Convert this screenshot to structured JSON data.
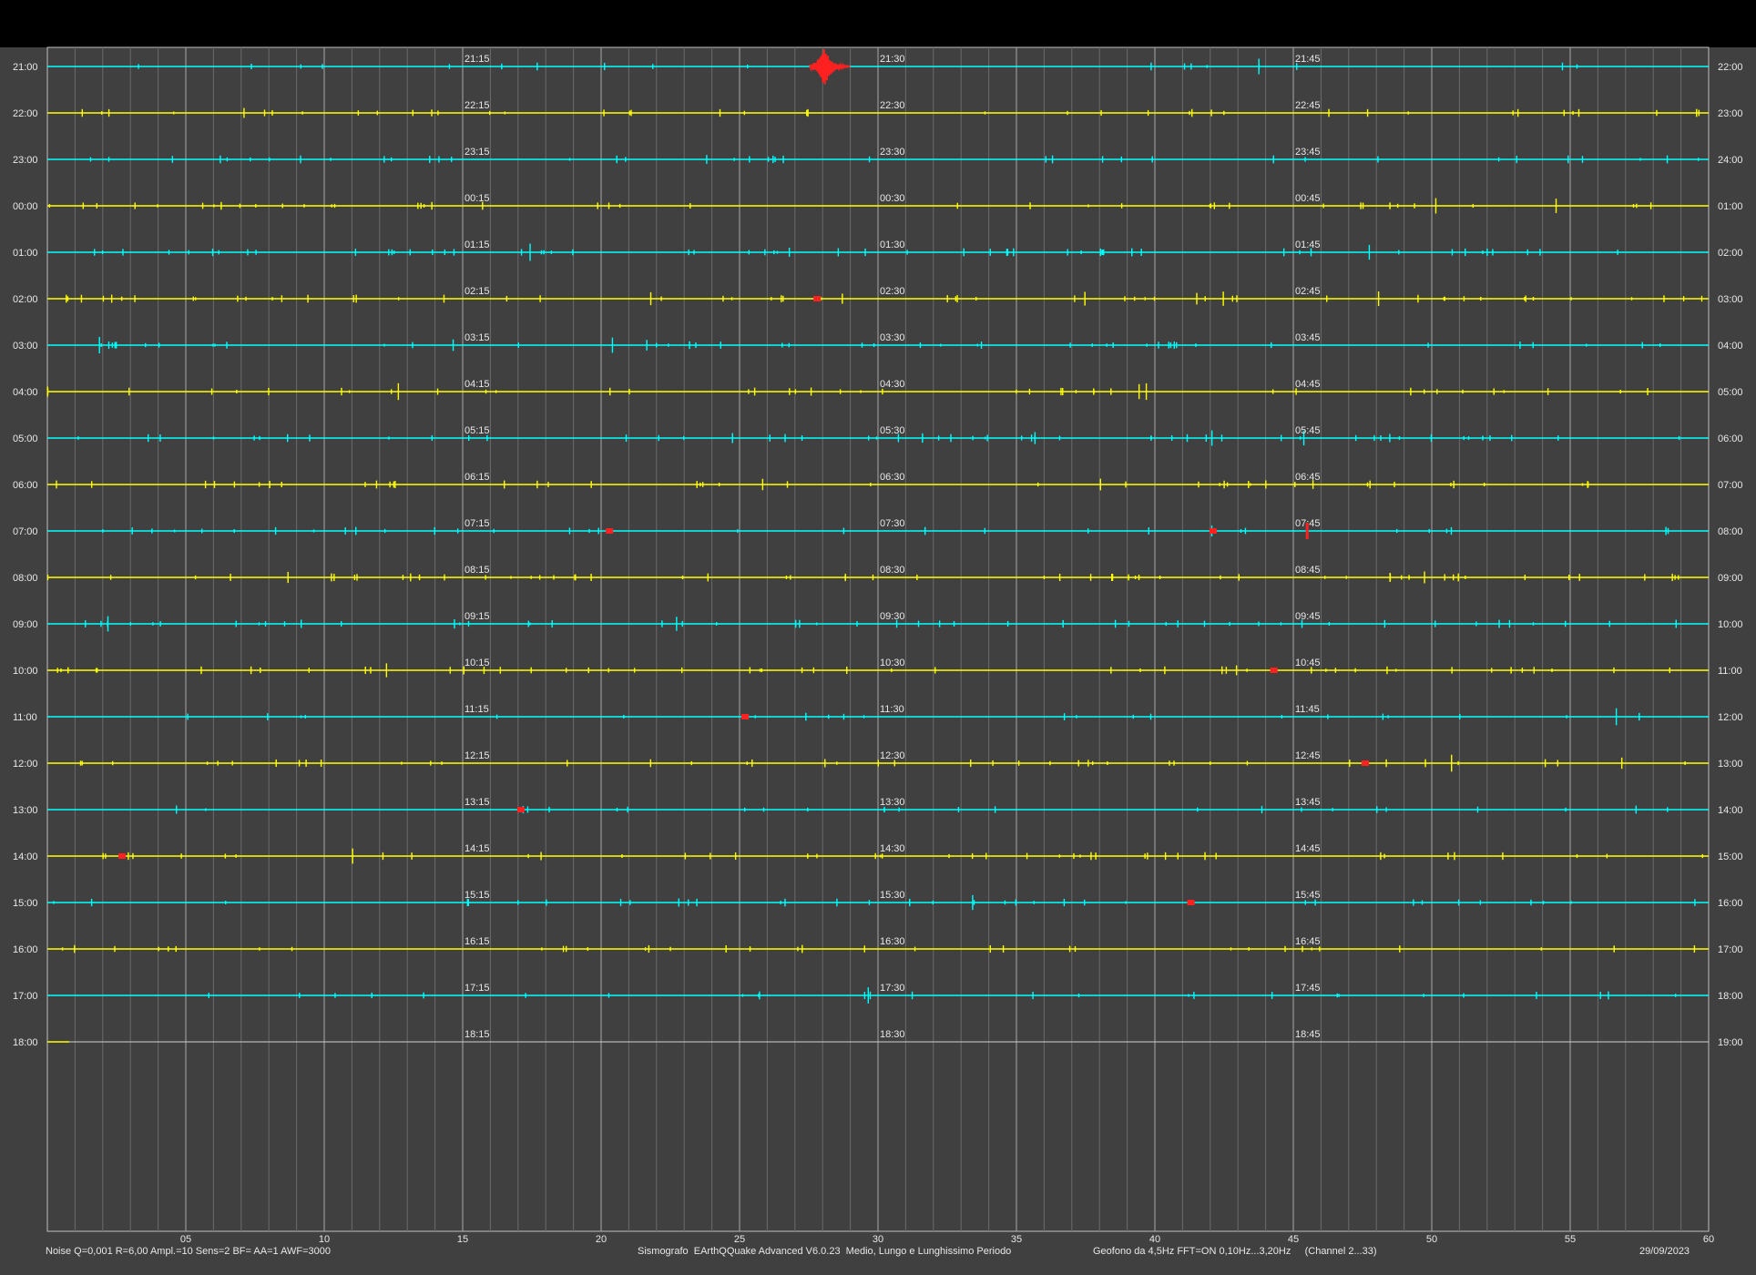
{
  "chart_data": {
    "type": "seismogram",
    "date": "29/09/2023",
    "x_axis_ticks": [
      "05",
      "10",
      "15",
      "20",
      "25",
      "30",
      "35",
      "40",
      "45",
      "50",
      "55",
      "60"
    ],
    "x_range_minutes": [
      0,
      60
    ],
    "trace_colors": [
      "#00ffff",
      "#ffff00"
    ],
    "event_color": "#ff2020",
    "rows": [
      {
        "left": "21:00",
        "right": "22:00",
        "q15": "21:15",
        "q30": "21:30",
        "q45": "21:45"
      },
      {
        "left": "22:00",
        "right": "23:00",
        "q15": "22:15",
        "q30": "22:30",
        "q45": "22:45"
      },
      {
        "left": "23:00",
        "right": "24:00",
        "q15": "23:15",
        "q30": "23:30",
        "q45": "23:45"
      },
      {
        "left": "00:00",
        "right": "01:00",
        "q15": "00:15",
        "q30": "00:30",
        "q45": "00:45"
      },
      {
        "left": "01:00",
        "right": "02:00",
        "q15": "01:15",
        "q30": "01:30",
        "q45": "01:45"
      },
      {
        "left": "02:00",
        "right": "03:00",
        "q15": "02:15",
        "q30": "02:30",
        "q45": "02:45"
      },
      {
        "left": "03:00",
        "right": "04:00",
        "q15": "03:15",
        "q30": "03:30",
        "q45": "03:45"
      },
      {
        "left": "04:00",
        "right": "05:00",
        "q15": "04:15",
        "q30": "04:30",
        "q45": "04:45"
      },
      {
        "left": "05:00",
        "right": "06:00",
        "q15": "05:15",
        "q30": "05:30",
        "q45": "05:45"
      },
      {
        "left": "06:00",
        "right": "07:00",
        "q15": "06:15",
        "q30": "06:30",
        "q45": "06:45"
      },
      {
        "left": "07:00",
        "right": "08:00",
        "q15": "07:15",
        "q30": "07:30",
        "q45": "07:45"
      },
      {
        "left": "08:00",
        "right": "09:00",
        "q15": "08:15",
        "q30": "08:30",
        "q45": "08:45"
      },
      {
        "left": "09:00",
        "right": "10:00",
        "q15": "09:15",
        "q30": "09:30",
        "q45": "09:45"
      },
      {
        "left": "10:00",
        "right": "11:00",
        "q15": "10:15",
        "q30": "10:30",
        "q45": "10:45"
      },
      {
        "left": "11:00",
        "right": "12:00",
        "q15": "11:15",
        "q30": "11:30",
        "q45": "11:45"
      },
      {
        "left": "12:00",
        "right": "13:00",
        "q15": "12:15",
        "q30": "12:30",
        "q45": "12:45"
      },
      {
        "left": "13:00",
        "right": "14:00",
        "q15": "13:15",
        "q30": "13:30",
        "q45": "13:45"
      },
      {
        "left": "14:00",
        "right": "15:00",
        "q15": "14:15",
        "q30": "14:30",
        "q45": "14:45"
      },
      {
        "left": "15:00",
        "right": "16:00",
        "q15": "15:15",
        "q30": "15:30",
        "q45": "15:45"
      },
      {
        "left": "16:00",
        "right": "17:00",
        "q15": "16:15",
        "q30": "16:30",
        "q45": "16:45"
      },
      {
        "left": "17:00",
        "right": "18:00",
        "q15": "17:15",
        "q30": "17:30",
        "q45": "17:45"
      },
      {
        "left": "18:00",
        "right": "19:00",
        "q15": "18:15",
        "q30": "18:30",
        "q45": "18:45"
      }
    ],
    "events": [
      {
        "row": 0,
        "minute": 28.0,
        "amplitude": "large",
        "color": "red"
      },
      {
        "row": 5,
        "minute": 27.8,
        "amplitude": "small",
        "color": "red"
      },
      {
        "row": 10,
        "minute": 20.3,
        "amplitude": "small",
        "color": "red"
      },
      {
        "row": 10,
        "minute": 42.1,
        "amplitude": "small",
        "color": "red"
      },
      {
        "row": 10,
        "minute": 45.5,
        "amplitude": "medium",
        "color": "red"
      },
      {
        "row": 13,
        "minute": 44.3,
        "amplitude": "small",
        "color": "red"
      },
      {
        "row": 14,
        "minute": 25.2,
        "amplitude": "small",
        "color": "red"
      },
      {
        "row": 15,
        "minute": 47.6,
        "amplitude": "small",
        "color": "red"
      },
      {
        "row": 16,
        "minute": 17.1,
        "amplitude": "small",
        "color": "red"
      },
      {
        "row": 17,
        "minute": 2.7,
        "amplitude": "small",
        "color": "red"
      },
      {
        "row": 18,
        "minute": 41.3,
        "amplitude": "small",
        "color": "red"
      }
    ],
    "last_row_end_minute": 0.8
  },
  "footer": {
    "left": "Noise Q=0,001 R=6,00 Ampl.=10 Sens=2 BF= AA=1 AWF=3000",
    "center": "Sismografo  EArthQQuake Advanced V6.0.23  Medio, Lungo e Lunghissimo Periodo",
    "right": "Geofono da 4,5Hz FFT=ON 0,10Hz...3,20Hz     (Channel 2...33)",
    "date": "29/09/2023"
  }
}
